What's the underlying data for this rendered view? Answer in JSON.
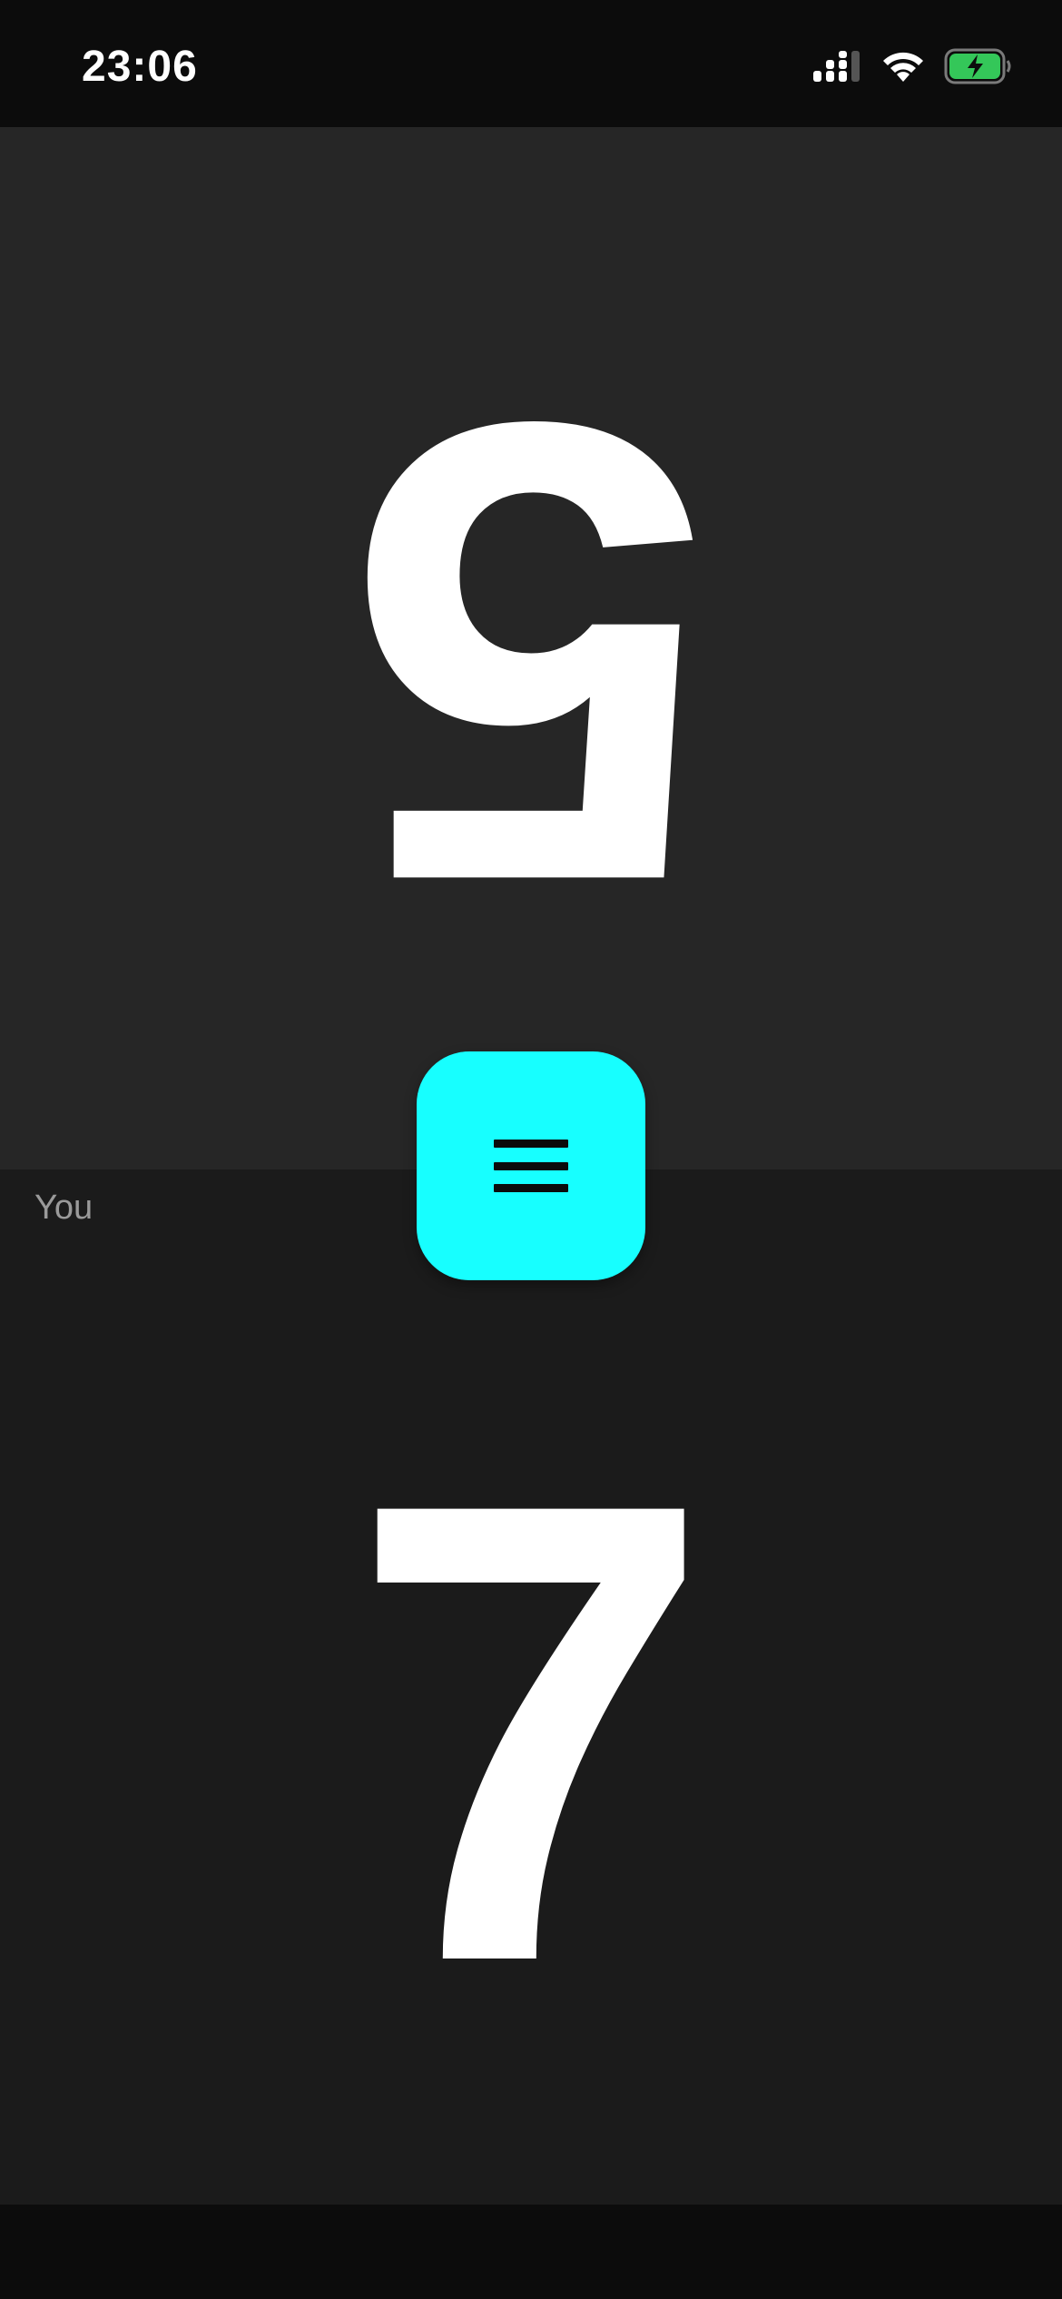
{
  "status_bar": {
    "time": "23:06",
    "icons": [
      "cellular-signal-icon",
      "wifi-icon",
      "battery-charging-icon"
    ],
    "battery_color": "#34c759"
  },
  "opponent": {
    "score": "5"
  },
  "player": {
    "label": "You",
    "score": "7"
  },
  "menu_button": {
    "icon": "menu-icon",
    "color": "#17ffff"
  }
}
